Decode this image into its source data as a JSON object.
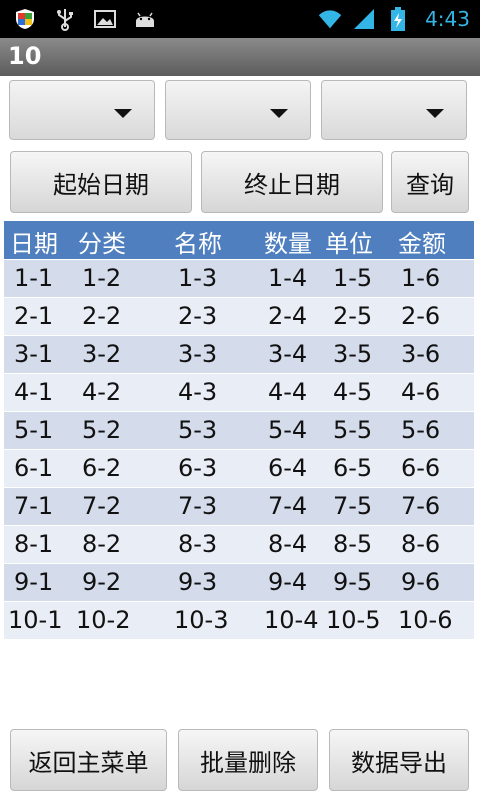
{
  "status_bar": {
    "icons_left": [
      "shield-icon",
      "usb-icon",
      "picture-icon",
      "android-icon"
    ],
    "icons_right": [
      "wifi-icon",
      "signal-icon",
      "battery-charging-icon"
    ],
    "time": "4:43",
    "accent_color": "#33b5e5"
  },
  "app": {
    "title": "10"
  },
  "spinners": [
    {
      "value": ""
    },
    {
      "value": ""
    },
    {
      "value": ""
    }
  ],
  "buttons": {
    "start_date": "起始日期",
    "end_date": "终止日期",
    "query": "查询",
    "back_menu": "返回主菜单",
    "batch_delete": "批量删除",
    "export": "数据导出"
  },
  "table": {
    "header_color": "#4f7fbf",
    "columns": [
      "日期",
      "分类",
      "名称",
      "数量",
      "单位",
      "金额"
    ],
    "rows": [
      [
        "1-1",
        "1-2",
        "1-3",
        "1-4",
        "1-5",
        "1-6"
      ],
      [
        "2-1",
        "2-2",
        "2-3",
        "2-4",
        "2-5",
        "2-6"
      ],
      [
        "3-1",
        "3-2",
        "3-3",
        "3-4",
        "3-5",
        "3-6"
      ],
      [
        "4-1",
        "4-2",
        "4-3",
        "4-4",
        "4-5",
        "4-6"
      ],
      [
        "5-1",
        "5-2",
        "5-3",
        "5-4",
        "5-5",
        "5-6"
      ],
      [
        "6-1",
        "6-2",
        "6-3",
        "6-4",
        "6-5",
        "6-6"
      ],
      [
        "7-1",
        "7-2",
        "7-3",
        "7-4",
        "7-5",
        "7-6"
      ],
      [
        "8-1",
        "8-2",
        "8-3",
        "8-4",
        "8-5",
        "8-6"
      ],
      [
        "9-1",
        "9-2",
        "9-3",
        "9-4",
        "9-5",
        "9-6"
      ],
      [
        "10-1",
        "10-2",
        "10-3",
        "10-4",
        "10-5",
        "10-6"
      ]
    ]
  }
}
